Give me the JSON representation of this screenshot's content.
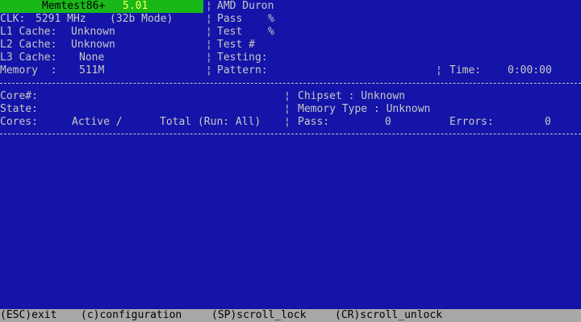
{
  "header": {
    "title": "Memtest86+",
    "version": "5.01"
  },
  "system": {
    "clk_label": "CLK:",
    "clk_value": "5291 MHz",
    "mode": "(32b Mode)",
    "l1_label": "L1 Cache:",
    "l1_value": "Unknown",
    "l2_label": "L2 Cache:",
    "l2_value": "Unknown",
    "l3_label": "L3 Cache:",
    "l3_value": "None",
    "memory_label": "Memory  :",
    "memory_value": "511M"
  },
  "test": {
    "cpu_name": "AMD Duron",
    "pass_label": "Pass",
    "pass_pct": "%",
    "test_label": "Test",
    "test_pct": "%",
    "test_num_label": "Test #",
    "testing_label": "Testing:",
    "pattern_label": "Pattern:",
    "time_label": "Time:",
    "time_value": "0:00:00"
  },
  "cores": {
    "core_label": "Core#:",
    "state_label": "State:",
    "cores_label": "Cores:",
    "active_label": "Active /",
    "total_label": "Total (Run: All)"
  },
  "chipset": {
    "chipset_label": "Chipset : Unknown",
    "memtype_label": "Memory Type : Unknown",
    "pass_label": "Pass:",
    "pass_value": "0",
    "errors_label": "Errors:",
    "errors_value": "0"
  },
  "separators": {
    "bar": "¦"
  },
  "footer": {
    "esc": "(ESC)exit",
    "config": "(c)configuration",
    "scroll_lock": "(SP)scroll_lock",
    "scroll_unlock": "(CR)scroll_unlock"
  },
  "colors": {
    "background": "#1414a8",
    "title_bar": "#18b818",
    "text": "#c8c8c8",
    "footer_bar": "#a8a8a8"
  }
}
